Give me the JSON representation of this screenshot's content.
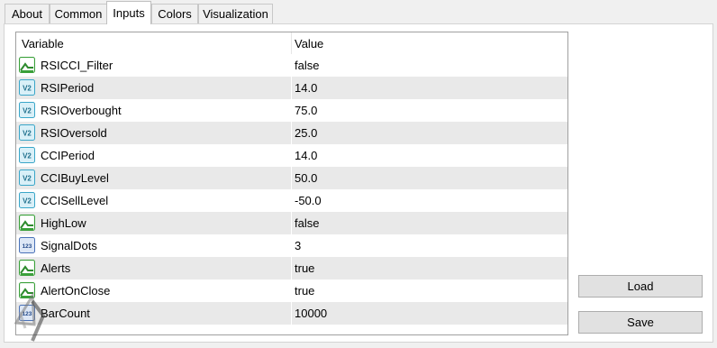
{
  "tabs": [
    {
      "label": "About",
      "active": false
    },
    {
      "label": "Common",
      "active": false
    },
    {
      "label": "Inputs",
      "active": true
    },
    {
      "label": "Colors",
      "active": false
    },
    {
      "label": "Visualization",
      "active": false
    }
  ],
  "grid": {
    "headers": {
      "variable": "Variable",
      "value": "Value"
    },
    "rows": [
      {
        "icon": "bool-icon",
        "name": "RSICCI_Filter",
        "value": "false"
      },
      {
        "icon": "double-icon",
        "name": "RSIPeriod",
        "value": "14.0"
      },
      {
        "icon": "double-icon",
        "name": "RSIOverbought",
        "value": "75.0"
      },
      {
        "icon": "double-icon",
        "name": "RSIOversold",
        "value": "25.0"
      },
      {
        "icon": "double-icon",
        "name": "CCIPeriod",
        "value": "14.0"
      },
      {
        "icon": "double-icon",
        "name": "CCIBuyLevel",
        "value": "50.0"
      },
      {
        "icon": "double-icon",
        "name": "CCISellLevel",
        "value": "-50.0"
      },
      {
        "icon": "bool-icon",
        "name": "HighLow",
        "value": "false"
      },
      {
        "icon": "int-icon",
        "name": "SignalDots",
        "value": "3"
      },
      {
        "icon": "bool-icon",
        "name": "Alerts",
        "value": "true"
      },
      {
        "icon": "bool-icon",
        "name": "AlertOnClose",
        "value": "true"
      },
      {
        "icon": "int-icon",
        "name": "BarCount",
        "value": "10000"
      }
    ]
  },
  "buttons": {
    "load": "Load",
    "save": "Save"
  },
  "icon_glyphs": {
    "double-icon": "V2",
    "int-icon": "123"
  },
  "colors": {
    "bool": "#3aa03a",
    "double": "#3aa6c8",
    "int": "#4a72b8",
    "row_alt": "#e9e9e9"
  }
}
